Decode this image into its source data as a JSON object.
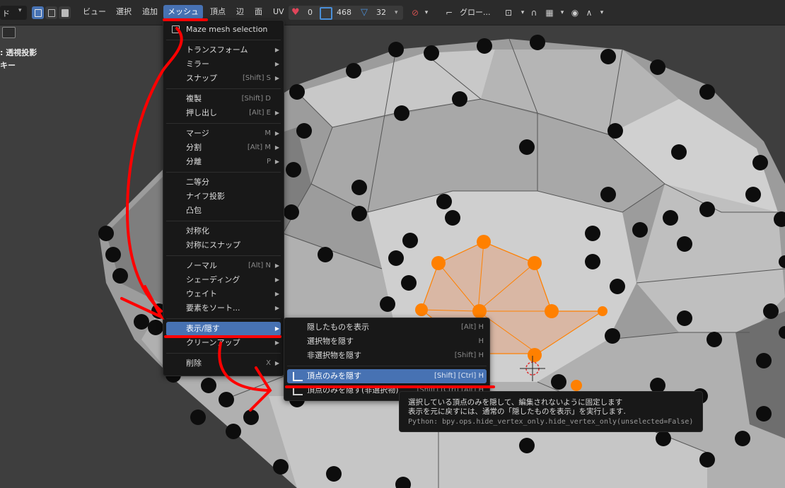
{
  "header": {
    "mode_label": "ド",
    "menus": [
      "ビュー",
      "選択",
      "追加",
      "メッシュ",
      "頂点",
      "辺",
      "面",
      "UV"
    ],
    "stats": {
      "faces": "0",
      "verts": "468",
      "edges": "32"
    },
    "orientation": "グロー..."
  },
  "left_overlay": {
    "projection": "透視投影",
    "line2": "キー"
  },
  "mesh_menu": {
    "items": [
      {
        "label": "Maze mesh selection",
        "shortcut": "",
        "submenu": false
      },
      {
        "label": "トランスフォーム",
        "shortcut": "",
        "submenu": true
      },
      {
        "label": "ミラー",
        "shortcut": "",
        "submenu": true
      },
      {
        "label": "スナップ",
        "shortcut": "[Shift] S",
        "submenu": true
      },
      {
        "label": "複製",
        "shortcut": "[Shift] D",
        "submenu": false
      },
      {
        "label": "押し出し",
        "shortcut": "[Alt] E",
        "submenu": true
      },
      {
        "label": "マージ",
        "shortcut": "M",
        "submenu": true
      },
      {
        "label": "分割",
        "shortcut": "[Alt] M",
        "submenu": true
      },
      {
        "label": "分離",
        "shortcut": "P",
        "submenu": true
      },
      {
        "label": "二等分",
        "shortcut": "",
        "submenu": false
      },
      {
        "label": "ナイフ投影",
        "shortcut": "",
        "submenu": false
      },
      {
        "label": "凸包",
        "shortcut": "",
        "submenu": false
      },
      {
        "label": "対称化",
        "shortcut": "",
        "submenu": false
      },
      {
        "label": "対称にスナップ",
        "shortcut": "",
        "submenu": false
      },
      {
        "label": "ノーマル",
        "shortcut": "[Alt] N",
        "submenu": true
      },
      {
        "label": "シェーディング",
        "shortcut": "",
        "submenu": true
      },
      {
        "label": "ウェイト",
        "shortcut": "",
        "submenu": true
      },
      {
        "label": "要素をソート...",
        "shortcut": "",
        "submenu": true
      },
      {
        "label": "表示/隠す",
        "shortcut": "",
        "submenu": true
      },
      {
        "label": "クリーンアップ",
        "shortcut": "",
        "submenu": true
      },
      {
        "label": "削除",
        "shortcut": "X",
        "submenu": true
      }
    ]
  },
  "hide_submenu": {
    "items": [
      {
        "label": "隠したものを表示",
        "shortcut": "[Alt] H"
      },
      {
        "label": "選択物を隠す",
        "shortcut": "H"
      },
      {
        "label": "非選択物を隠す",
        "shortcut": "[Shift] H"
      },
      {
        "label": "頂点のみを隠す",
        "shortcut": "[Shift] [Ctrl] H"
      },
      {
        "label": "頂点のみを隠す(非選択物)",
        "shortcut": "[Shift] [Ctrl] [Alt] H"
      }
    ]
  },
  "tooltip": {
    "line1": "選択している頂点のみを隠して、編集されないように固定します",
    "line2": "表示を元に戻すには、通常の「隠したものを表示」を実行します.",
    "python": "Python: bpy.ops.hide_vertex_only.hide_vertex_only(unselected=False)"
  },
  "colors": {
    "accent": "#4772b3",
    "selected_vertex": "#ff8000",
    "annotation": "#ff0000"
  }
}
